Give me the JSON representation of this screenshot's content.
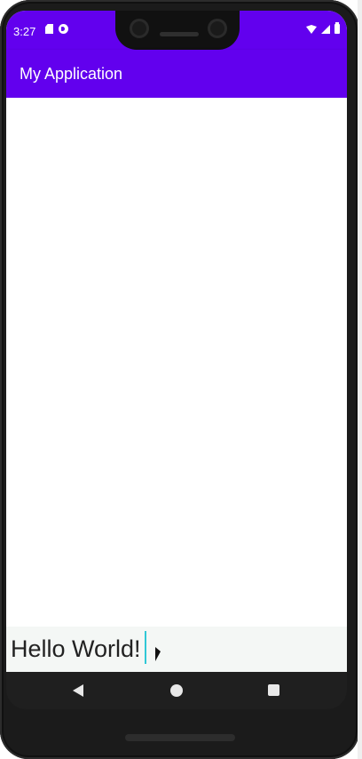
{
  "status_bar": {
    "time": "3:27",
    "left_icons": [
      "sd-card-icon",
      "play-protect-icon"
    ],
    "right_icons": [
      "wifi-icon",
      "signal-icon",
      "battery-icon"
    ]
  },
  "app_bar": {
    "title": "My Application",
    "color": "#6200ee"
  },
  "content": {
    "text": "Hello World!"
  },
  "nav_bar": {
    "icons": [
      "back-icon",
      "home-icon",
      "recents-icon"
    ]
  }
}
